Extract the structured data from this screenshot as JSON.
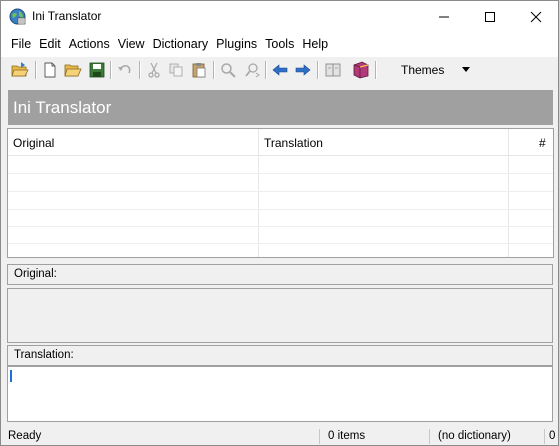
{
  "window": {
    "title": "Ini Translator"
  },
  "menu": [
    "File",
    "Edit",
    "Actions",
    "View",
    "Dictionary",
    "Plugins",
    "Tools",
    "Help"
  ],
  "toolbar": {
    "themes_label": "Themes",
    "icons": [
      "open-project-icon",
      "new-file-icon",
      "open-folder-icon",
      "save-icon",
      "undo-icon",
      "cut-icon",
      "copy-icon",
      "paste-icon",
      "find-icon",
      "replace-icon",
      "previous-icon",
      "next-icon",
      "dictionary-lookup-icon",
      "dictionary-book-icon"
    ]
  },
  "banner": {
    "title": "Ini Translator"
  },
  "grid": {
    "columns": [
      "Original",
      "Translation",
      "#"
    ],
    "rows": []
  },
  "original_section": {
    "label": "Original:"
  },
  "translation_section": {
    "label": "Translation:"
  },
  "status": {
    "state": "Ready",
    "items": "0 items",
    "dictionary": "(no dictionary)",
    "extra": "0"
  },
  "colors": {
    "banner": "#a0a0a0",
    "caret": "#1e6fd9"
  }
}
